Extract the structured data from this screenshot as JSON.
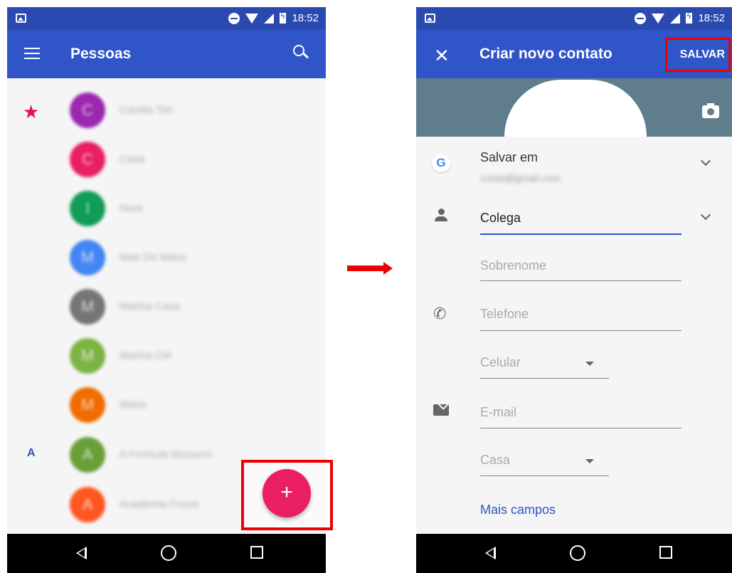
{
  "status_bar": {
    "time": "18:52"
  },
  "left_screen": {
    "title": "Pessoas",
    "icons": {
      "menu": "menu-icon",
      "search": "search-icon",
      "favorite": "star-icon",
      "add": "plus-icon"
    },
    "contacts": [
      {
        "initial": "C",
        "name": "Camila Tim",
        "color": "#9c27b0"
      },
      {
        "initial": "C",
        "name": "Casa",
        "color": "#e91e63"
      },
      {
        "initial": "I",
        "name": "Nora",
        "color": "#0f9d58"
      },
      {
        "initial": "M",
        "name": "Mae Do Mario",
        "color": "#4285f4"
      },
      {
        "initial": "M",
        "name": "Marina Casa",
        "color": "#757575"
      },
      {
        "initial": "M",
        "name": "Marina Cel",
        "color": "#7cb342"
      },
      {
        "initial": "M",
        "name": "Mario",
        "color": "#ef6c00"
      },
      {
        "initial": "A",
        "name": "A Formula Mossoro",
        "color": "#689f38"
      },
      {
        "initial": "A",
        "name": "Academia Focus",
        "color": "#ff5722"
      }
    ],
    "section_letter": "A",
    "fab_label": "+"
  },
  "right_screen": {
    "title": "Criar novo contato",
    "close_label": "✕",
    "save_label": "SALVAR",
    "save_in_label": "Salvar em",
    "account_blurred": "conta@gmail.com",
    "first_name_value": "Colega",
    "last_name_placeholder": "Sobrenome",
    "phone_placeholder": "Telefone",
    "phone_type": "Celular",
    "email_placeholder": "E-mail",
    "email_type": "Casa",
    "more_fields": "Mais campos"
  },
  "colors": {
    "app_bar": "#2f55c8",
    "status_bar": "#2a4ab0",
    "fab": "#e91e63",
    "highlight": "#ee0000",
    "photo_header": "#607d8b"
  }
}
